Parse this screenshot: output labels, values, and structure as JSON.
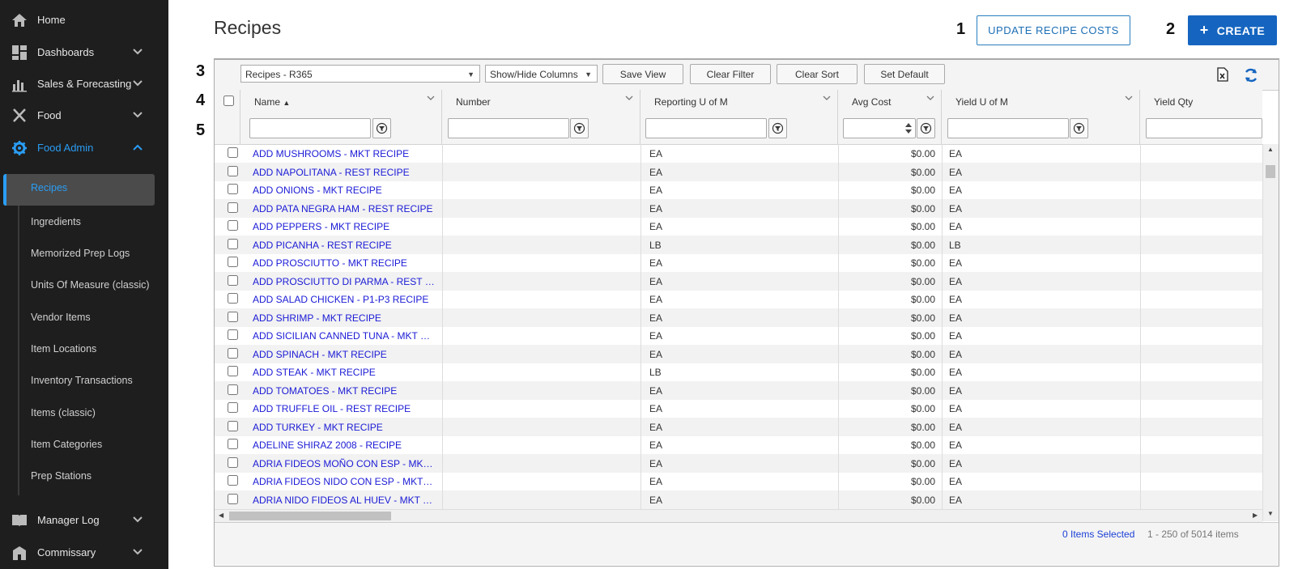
{
  "sidebar": {
    "items": [
      {
        "label": "Home",
        "icon": "home-icon"
      },
      {
        "label": "Dashboards",
        "icon": "dashboard-icon"
      },
      {
        "label": "Sales & Forecasting",
        "icon": "bar-chart-icon"
      },
      {
        "label": "Food",
        "icon": "utensils-icon"
      },
      {
        "label": "Food Admin",
        "icon": "gear-icon"
      },
      {
        "label": "Manager Log",
        "icon": "book-icon"
      },
      {
        "label": "Commissary",
        "icon": "building-icon"
      }
    ],
    "sub_items": [
      "Recipes",
      "Ingredients",
      "Memorized Prep Logs",
      "Units Of Measure (classic)",
      "Vendor Items",
      "Item Locations",
      "Inventory Transactions",
      "Items (classic)",
      "Item Categories",
      "Prep Stations"
    ],
    "accent_color": "#2a9df4"
  },
  "header": {
    "title": "Recipes",
    "update_button": "UPDATE RECIPE COSTS",
    "create_button": "CREATE",
    "create_icon": "+"
  },
  "annotations": [
    "1",
    "2",
    "3",
    "4",
    "5"
  ],
  "toolbar": {
    "view_select": "Recipes - R365",
    "columns_select": "Show/Hide Columns",
    "save_view": "Save View",
    "clear_filter": "Clear Filter",
    "clear_sort": "Clear Sort",
    "set_default": "Set Default"
  },
  "columns": [
    "Name",
    "Number",
    "Reporting U of M",
    "Avg Cost",
    "Yield U of M",
    "Yield Qty"
  ],
  "sort_indicator": "▲",
  "rows": [
    {
      "name": "ADD MUSHROOMS - MKT RECIPE",
      "number": "",
      "rum": "EA",
      "cost": "$0.00",
      "yum": "EA"
    },
    {
      "name": "ADD NAPOLITANA - REST RECIPE",
      "number": "",
      "rum": "EA",
      "cost": "$0.00",
      "yum": "EA"
    },
    {
      "name": "ADD ONIONS - MKT RECIPE",
      "number": "",
      "rum": "EA",
      "cost": "$0.00",
      "yum": "EA"
    },
    {
      "name": "ADD PATA NEGRA HAM - REST RECIPE",
      "number": "",
      "rum": "EA",
      "cost": "$0.00",
      "yum": "EA"
    },
    {
      "name": "ADD PEPPERS - MKT RECIPE",
      "number": "",
      "rum": "EA",
      "cost": "$0.00",
      "yum": "EA"
    },
    {
      "name": "ADD PICANHA - REST RECIPE",
      "number": "",
      "rum": "LB",
      "cost": "$0.00",
      "yum": "LB"
    },
    {
      "name": "ADD PROSCIUTTO - MKT RECIPE",
      "number": "",
      "rum": "EA",
      "cost": "$0.00",
      "yum": "EA"
    },
    {
      "name": "ADD PROSCIUTTO DI PARMA - REST RECIPE",
      "number": "",
      "rum": "EA",
      "cost": "$0.00",
      "yum": "EA"
    },
    {
      "name": "ADD SALAD CHICKEN - P1-P3 RECIPE",
      "number": "",
      "rum": "EA",
      "cost": "$0.00",
      "yum": "EA"
    },
    {
      "name": "ADD SHRIMP - MKT RECIPE",
      "number": "",
      "rum": "EA",
      "cost": "$0.00",
      "yum": "EA"
    },
    {
      "name": "ADD SICILIAN CANNED TUNA - MKT RECIPE",
      "number": "",
      "rum": "EA",
      "cost": "$0.00",
      "yum": "EA"
    },
    {
      "name": "ADD SPINACH - MKT RECIPE",
      "number": "",
      "rum": "EA",
      "cost": "$0.00",
      "yum": "EA"
    },
    {
      "name": "ADD STEAK - MKT RECIPE",
      "number": "",
      "rum": "LB",
      "cost": "$0.00",
      "yum": "EA"
    },
    {
      "name": "ADD TOMATOES - MKT RECIPE",
      "number": "",
      "rum": "EA",
      "cost": "$0.00",
      "yum": "EA"
    },
    {
      "name": "ADD TRUFFLE OIL - REST RECIPE",
      "number": "",
      "rum": "EA",
      "cost": "$0.00",
      "yum": "EA"
    },
    {
      "name": "ADD TURKEY - MKT RECIPE",
      "number": "",
      "rum": "EA",
      "cost": "$0.00",
      "yum": "EA"
    },
    {
      "name": "ADELINE SHIRAZ 2008 - RECIPE",
      "number": "",
      "rum": "EA",
      "cost": "$0.00",
      "yum": "EA"
    },
    {
      "name": "ADRIA FIDEOS MOÑO CON ESP - MKT RECIPE",
      "number": "",
      "rum": "EA",
      "cost": "$0.00",
      "yum": "EA"
    },
    {
      "name": "ADRIA FIDEOS NIDO CON ESP - MKT RECIPE",
      "number": "",
      "rum": "EA",
      "cost": "$0.00",
      "yum": "EA"
    },
    {
      "name": "ADRIA NIDO FIDEOS AL HUEV - MKT RECIPE",
      "number": "",
      "rum": "EA",
      "cost": "$0.00",
      "yum": "EA"
    }
  ],
  "footer": {
    "selected": "0 Items Selected",
    "count": "1 - 250 of 5014 items"
  }
}
